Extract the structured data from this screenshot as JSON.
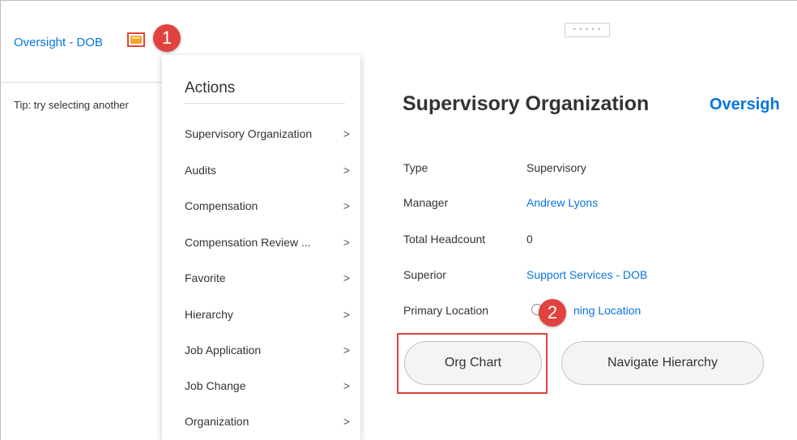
{
  "breadcrumb": {
    "label": "Oversight - DOB",
    "related_actions_icon": "ellipsis-icon"
  },
  "callouts": {
    "first": "1",
    "second": "2"
  },
  "left_panel": {
    "tip": "Tip: try selecting another"
  },
  "actions_menu": {
    "title": "Actions",
    "items": [
      {
        "label": "Supervisory Organization",
        "chevron": ">"
      },
      {
        "label": "Audits",
        "chevron": ">"
      },
      {
        "label": "Compensation",
        "chevron": ">"
      },
      {
        "label": "Compensation Review ...",
        "chevron": ">"
      },
      {
        "label": "Favorite",
        "chevron": ">"
      },
      {
        "label": "Hierarchy",
        "chevron": ">"
      },
      {
        "label": "Job Application",
        "chevron": ">"
      },
      {
        "label": "Job Change",
        "chevron": ">"
      },
      {
        "label": "Organization",
        "chevron": ">"
      }
    ]
  },
  "main": {
    "drag_handle": "• • • • •",
    "title": "Supervisory Organization",
    "title_link": "Oversigh",
    "fields": [
      {
        "label": "Type",
        "value": "Supervisory"
      },
      {
        "label": "Manager",
        "value": "Andrew Lyons"
      },
      {
        "label": "Total Headcount",
        "value": "0"
      },
      {
        "label": "Superior",
        "value": "Support Services - DOB"
      },
      {
        "label": "Primary Location",
        "value": "ning Location"
      }
    ],
    "buttons": {
      "org_chart": "Org Chart",
      "navigate_hierarchy": "Navigate Hierarchy"
    }
  },
  "colors": {
    "link": "#0875e1",
    "callout": "#e0433f",
    "related_icon": "#f5a623"
  }
}
